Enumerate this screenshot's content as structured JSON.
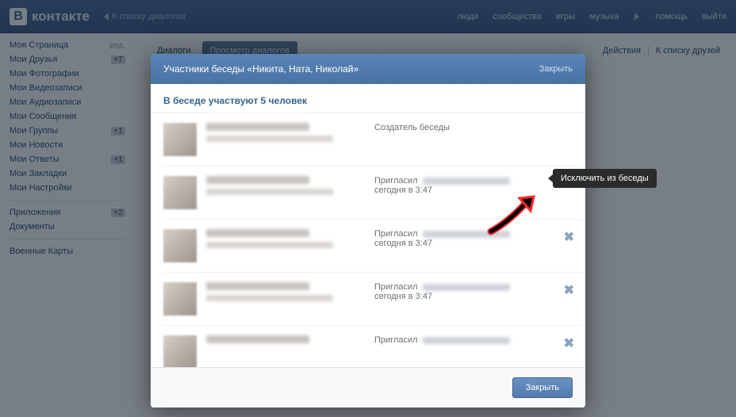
{
  "topbar": {
    "logo_text": "контакте",
    "back_label": "К списку диалогов",
    "nav": {
      "people": "люди",
      "communities": "сообщества",
      "games": "игры",
      "music": "музыка",
      "help": "помощь",
      "logout": "выйти"
    }
  },
  "sidebar": {
    "items": [
      {
        "label": "Моя Страница",
        "tag": "ред."
      },
      {
        "label": "Мои Друзья",
        "badge": "+7"
      },
      {
        "label": "Мои Фотографии"
      },
      {
        "label": "Мои Видеозаписи"
      },
      {
        "label": "Мои Аудиозаписи"
      },
      {
        "label": "Мои Сообщения"
      },
      {
        "label": "Мои Группы",
        "badge": "+1"
      },
      {
        "label": "Мои Новости"
      },
      {
        "label": "Мои Ответы",
        "badge": "+1"
      },
      {
        "label": "Мои Закладки"
      },
      {
        "label": "Мои Настройки"
      }
    ],
    "items2": [
      {
        "label": "Приложения",
        "badge": "+2"
      },
      {
        "label": "Документы"
      }
    ],
    "items3": [
      {
        "label": "Военные Карты"
      }
    ]
  },
  "tabs": {
    "dialogs": "Диалоги",
    "view_dialogs": "Просмотр диалогов",
    "actions": "Действия",
    "to_friends": "К списку друзей"
  },
  "modal": {
    "title": "Участники беседы «Никита, Ната, Николай»",
    "close_top": "Закрыть",
    "subtitle": "В беседе участвуют 5 человек",
    "creator_label": "Создатель беседы",
    "invited_prefix": "Пригласил",
    "invited_time": "сегодня в 3:47",
    "close_btn": "Закрыть",
    "tooltip": "Исключить из беседы",
    "remove_glyph": "✖"
  }
}
